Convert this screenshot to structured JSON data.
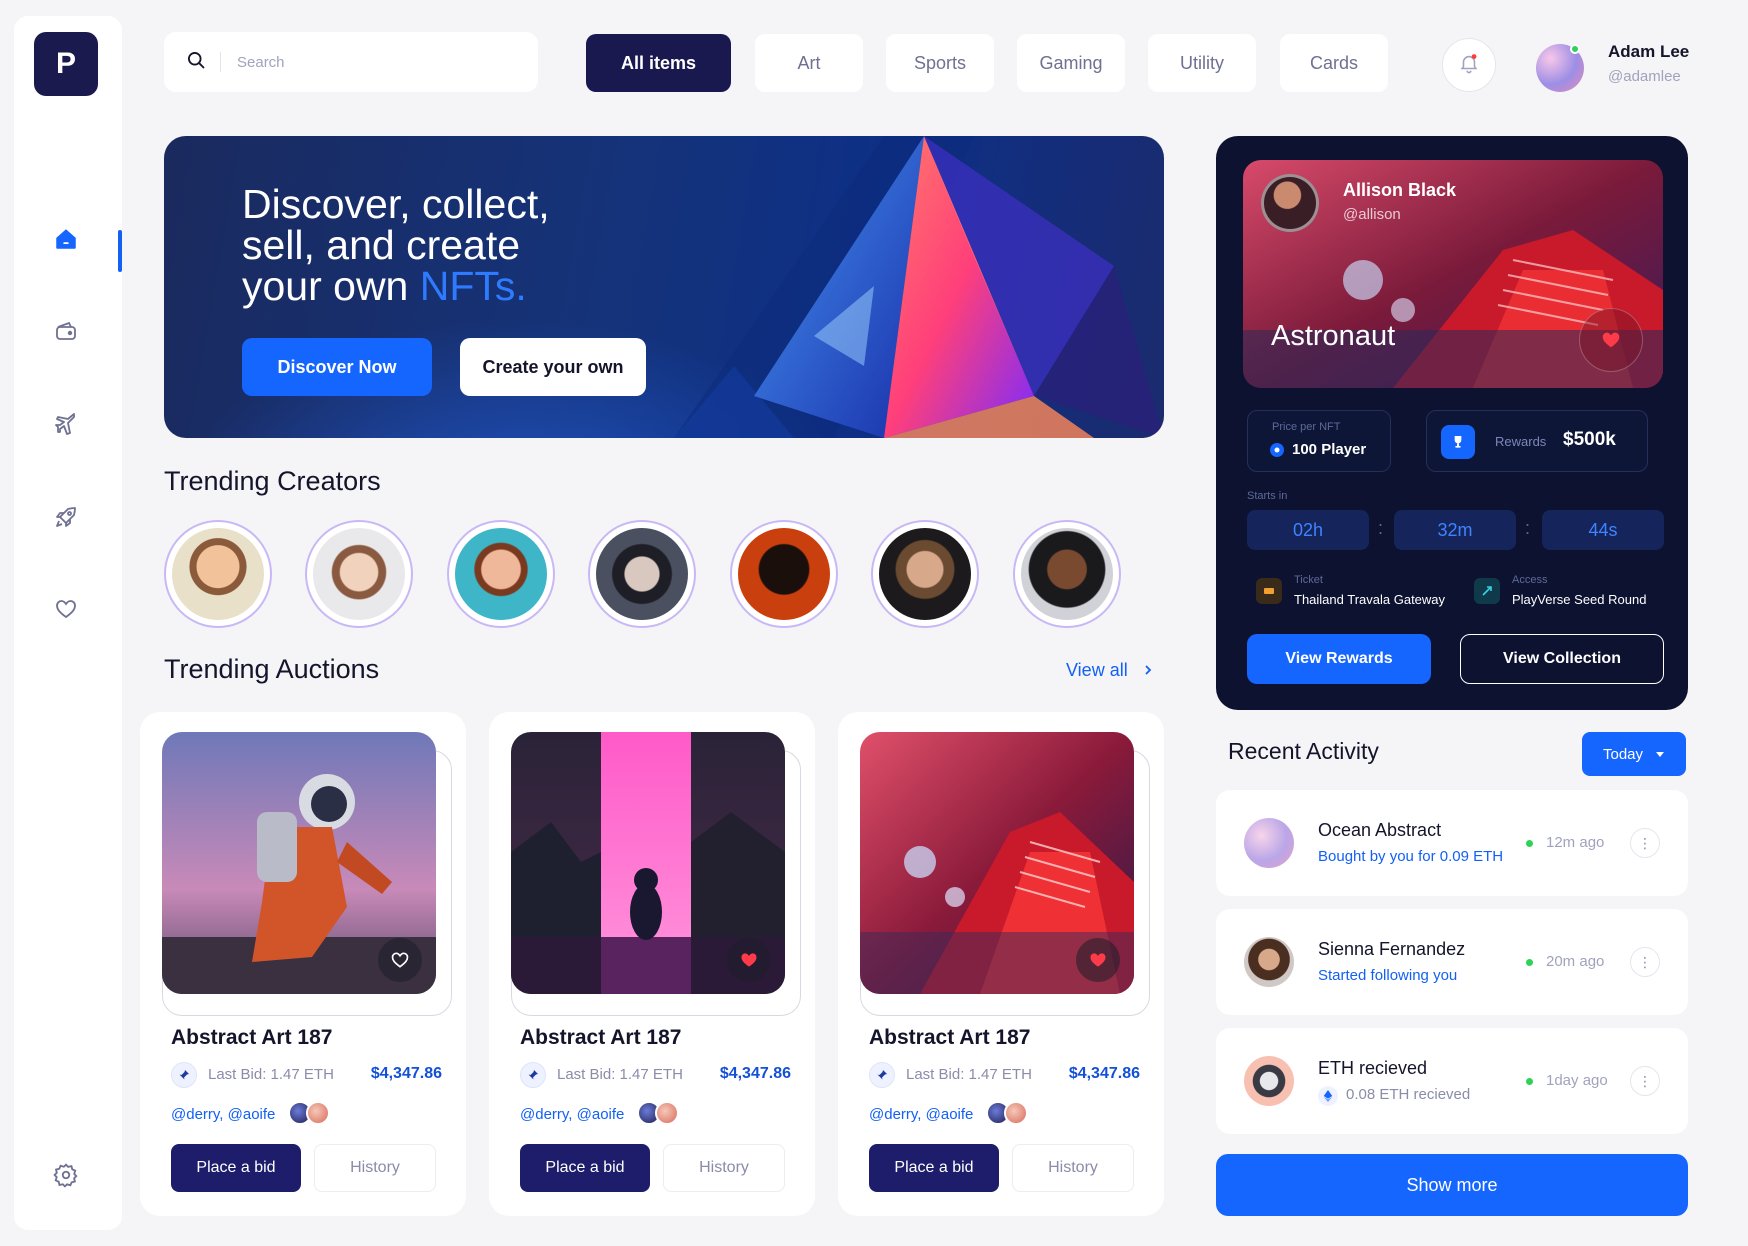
{
  "brand": {
    "logo_letter": "P"
  },
  "sidebar": {
    "items": [
      {
        "name": "home",
        "icon": "home-icon",
        "active": true
      },
      {
        "name": "wallet",
        "icon": "wallet-icon",
        "active": false
      },
      {
        "name": "explore",
        "icon": "plane-icon",
        "active": false
      },
      {
        "name": "launch",
        "icon": "rocket-icon",
        "active": false
      },
      {
        "name": "favorites",
        "icon": "heart-icon",
        "active": false
      }
    ],
    "settings_icon": "gear-icon"
  },
  "search": {
    "placeholder": "Search",
    "value": ""
  },
  "tabs": [
    {
      "label": "All items",
      "active": true
    },
    {
      "label": "Art",
      "active": false
    },
    {
      "label": "Sports",
      "active": false
    },
    {
      "label": "Gaming",
      "active": false
    },
    {
      "label": "Utility",
      "active": false
    },
    {
      "label": "Cards",
      "active": false
    }
  ],
  "user": {
    "name": "Adam Lee",
    "handle": "@adamlee",
    "online": true,
    "has_notification": true
  },
  "hero": {
    "line1": "Discover, collect,",
    "line2": "sell, and create",
    "line3_plain": "your own ",
    "line3_accent": "NFTs.",
    "primary_label": "Discover Now",
    "secondary_label": "Create your own"
  },
  "trending_creators": {
    "title": "Trending Creators",
    "count": 7
  },
  "trending_auctions": {
    "title": "Trending Auctions",
    "view_all": "View all",
    "items": [
      {
        "title": "Abstract Art 187",
        "last_bid": "Last Bid: 1.47 ETH",
        "price": "$4,347.86",
        "handles": "@derry, @aoife",
        "place_bid": "Place a bid",
        "history": "History",
        "liked": false
      },
      {
        "title": "Abstract Art 187",
        "last_bid": "Last Bid: 1.47 ETH",
        "price": "$4,347.86",
        "handles": "@derry, @aoife",
        "place_bid": "Place a bid",
        "history": "History",
        "liked": true
      },
      {
        "title": "Abstract Art 187",
        "last_bid": "Last Bid: 1.47 ETH",
        "price": "$4,347.86",
        "handles": "@derry, @aoife",
        "place_bid": "Place a bid",
        "history": "History",
        "liked": true
      }
    ]
  },
  "featured": {
    "creator_name": "Allison Black",
    "creator_handle": "@allison",
    "art_title": "Astronaut",
    "price_label": "Price per NFT",
    "price_value": "100 Player",
    "rewards_label": "Rewards",
    "rewards_value": "$500k",
    "starts_label": "Starts in",
    "timer": {
      "hours": "02h",
      "minutes": "32m",
      "seconds": "44s"
    },
    "ticket_label": "Ticket",
    "ticket_value": "Thailand Travala Gateway",
    "access_label": "Access",
    "access_value": "PlayVerse Seed Round",
    "rewards_button": "View Rewards",
    "collection_button": "View Collection"
  },
  "recent_activity": {
    "title": "Recent Activity",
    "filter": "Today",
    "items": [
      {
        "title": "Ocean Abstract",
        "subtitle": "Bought by you for 0.09 ETH",
        "time": "12m ago"
      },
      {
        "title": "Sienna Fernandez",
        "subtitle": "Started following you",
        "time": "20m ago"
      },
      {
        "title": "ETH recieved",
        "subtitle": "0.08 ETH recieved",
        "time": "1day ago"
      }
    ],
    "show_more": "Show more"
  },
  "colors": {
    "primary": "#1565ff",
    "navy": "#191950",
    "dark_card": "#0c1230",
    "online": "#30d158"
  }
}
